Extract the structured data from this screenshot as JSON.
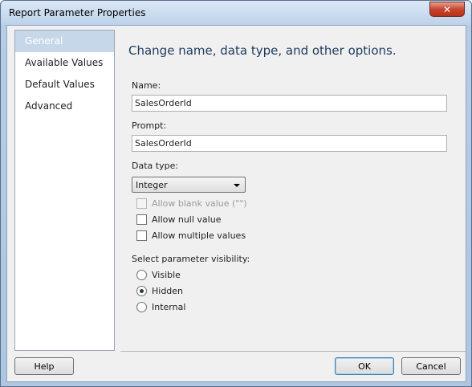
{
  "window": {
    "title": "Report Parameter Properties",
    "close_glyph": "✕"
  },
  "nav": {
    "items": [
      {
        "label": "General",
        "selected": true
      },
      {
        "label": "Available Values",
        "selected": false
      },
      {
        "label": "Default Values",
        "selected": false
      },
      {
        "label": "Advanced",
        "selected": false
      }
    ]
  },
  "main": {
    "heading": "Change name, data type, and other options.",
    "name_label": "Name:",
    "name_value": "SalesOrderId",
    "prompt_label": "Prompt:",
    "prompt_value": "SalesOrderId",
    "datatype_label": "Data type:",
    "datatype_value": "Integer",
    "checkboxes": [
      {
        "label": "Allow blank value (\"\")",
        "checked": false,
        "disabled": true
      },
      {
        "label": "Allow null value",
        "checked": false,
        "disabled": false
      },
      {
        "label": "Allow multiple values",
        "checked": false,
        "disabled": false
      }
    ],
    "visibility_label": "Select parameter visibility:",
    "radios": [
      {
        "label": "Visible",
        "selected": false
      },
      {
        "label": "Hidden",
        "selected": true
      },
      {
        "label": "Internal",
        "selected": false
      }
    ]
  },
  "footer": {
    "help_label": "Help",
    "ok_label": "OK",
    "cancel_label": "Cancel"
  }
}
